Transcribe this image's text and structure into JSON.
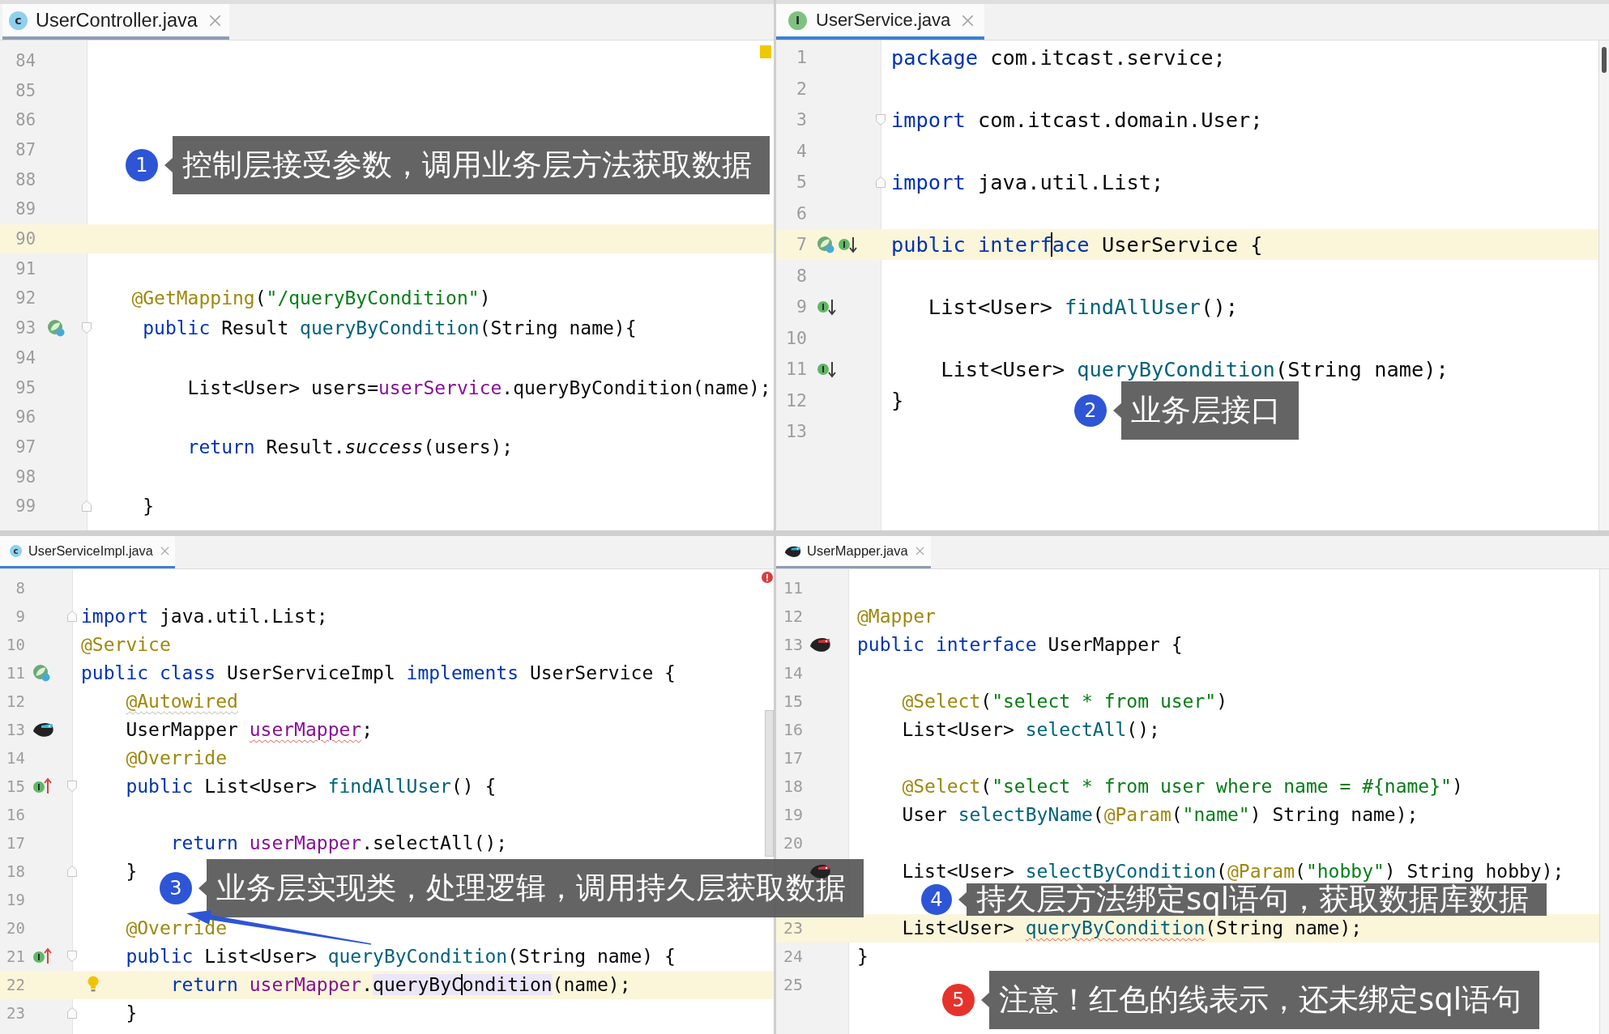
{
  "panes": [
    {
      "tab": {
        "label": "UserController.java",
        "icon": {
          "kind": "class",
          "letter": "c"
        },
        "selected": true
      },
      "focused": false,
      "indicator": {
        "kind": "warning"
      },
      "lines": [
        {
          "number": "84",
          "current": false
        },
        {
          "number": "85",
          "current": false
        },
        {
          "number": "86",
          "current": false
        },
        {
          "number": "87",
          "current": false
        },
        {
          "number": "88",
          "current": false
        },
        {
          "number": "89",
          "current": false
        },
        {
          "number": "90",
          "current": true
        },
        {
          "number": "91",
          "current": false
        },
        {
          "number": "92",
          "current": false,
          "code": [
            {
              "kind": "annotation",
              "text": "    @GetMapping"
            },
            {
              "kind": "plain",
              "text": "("
            },
            {
              "kind": "string",
              "text": "\"/queryByCondition\""
            },
            {
              "kind": "plain",
              "text": ")"
            }
          ]
        },
        {
          "number": "93",
          "current": false,
          "gutter": [
            {
              "kind": "bean"
            }
          ],
          "fold": {
            "kind": "start"
          },
          "code": [
            {
              "kind": "keyword",
              "text": "     public"
            },
            {
              "kind": "plain",
              "text": " Result "
            },
            {
              "kind": "method",
              "text": "queryByCondition"
            },
            {
              "kind": "plain",
              "text": "(String name){"
            }
          ]
        },
        {
          "number": "94",
          "current": false
        },
        {
          "number": "95",
          "current": false,
          "code": [
            {
              "kind": "plain",
              "text": "         List<User> users="
            },
            {
              "kind": "field",
              "text": "userService"
            },
            {
              "kind": "plain",
              "text": ".queryByCondition(name);"
            }
          ]
        },
        {
          "number": "96",
          "current": false
        },
        {
          "number": "97",
          "current": false,
          "code": [
            {
              "kind": "keyword",
              "text": "         return"
            },
            {
              "kind": "plain",
              "text": " Result."
            },
            {
              "kind": "static",
              "text": "success"
            },
            {
              "kind": "plain",
              "text": "(users);"
            }
          ]
        },
        {
          "number": "98",
          "current": false
        },
        {
          "number": "99",
          "current": false,
          "fold": {
            "kind": "end"
          },
          "code": [
            {
              "kind": "plain",
              "text": "     }"
            }
          ]
        }
      ]
    },
    {
      "tab": {
        "label": "UserService.java",
        "icon": {
          "kind": "interface",
          "letter": "I"
        },
        "selected": true
      },
      "focused": true,
      "lines": [
        {
          "number": "1",
          "current": false,
          "code": [
            {
              "kind": "keyword",
              "text": "package"
            },
            {
              "kind": "plain",
              "text": " com.itcast.service;"
            }
          ]
        },
        {
          "number": "2",
          "current": false
        },
        {
          "number": "3",
          "current": false,
          "fold": {
            "kind": "start"
          },
          "code": [
            {
              "kind": "keyword",
              "text": "import"
            },
            {
              "kind": "plain",
              "text": " com.itcast.domain.User;"
            }
          ]
        },
        {
          "number": "4",
          "current": false
        },
        {
          "number": "5",
          "current": false,
          "fold": {
            "kind": "end"
          },
          "code": [
            {
              "kind": "keyword",
              "text": "import"
            },
            {
              "kind": "plain",
              "text": " java.util.List;"
            }
          ]
        },
        {
          "number": "6",
          "current": false
        },
        {
          "number": "7",
          "current": true,
          "gutter": [
            {
              "kind": "bean"
            },
            {
              "kind": "implemented"
            }
          ],
          "code": [
            {
              "kind": "keyword",
              "text": "public interf",
              "cursor": true
            },
            {
              "kind": "keyword",
              "text": "ace"
            },
            {
              "kind": "plain",
              "text": " UserService {"
            }
          ]
        },
        {
          "number": "8",
          "current": false
        },
        {
          "number": "9",
          "current": false,
          "gutter": [
            {
              "kind": "implemented"
            }
          ],
          "code": [
            {
              "kind": "plain",
              "text": "   List<User> "
            },
            {
              "kind": "method",
              "text": "findAllUser"
            },
            {
              "kind": "plain",
              "text": "();"
            }
          ]
        },
        {
          "number": "10",
          "current": false
        },
        {
          "number": "11",
          "current": false,
          "gutter": [
            {
              "kind": "implemented"
            }
          ],
          "code": [
            {
              "kind": "plain",
              "text": "    List<User> "
            },
            {
              "kind": "method",
              "text": "queryByCondition"
            },
            {
              "kind": "plain",
              "text": "(String name);"
            }
          ]
        },
        {
          "number": "12",
          "current": false,
          "code": [
            {
              "kind": "plain",
              "text": "}"
            }
          ]
        },
        {
          "number": "13",
          "current": false
        }
      ]
    },
    {
      "tab": {
        "label": "UserServiceImpl.java",
        "icon": {
          "kind": "class",
          "letter": "c"
        },
        "selected": true
      },
      "focused": true,
      "indicator": {
        "kind": "error"
      },
      "lines": [
        {
          "number": "8",
          "current": false
        },
        {
          "number": "9",
          "current": false,
          "fold": {
            "kind": "end"
          },
          "code": [
            {
              "kind": "keyword",
              "text": "import"
            },
            {
              "kind": "plain",
              "text": " java.util.List;"
            }
          ]
        },
        {
          "number": "10",
          "current": false,
          "code": [
            {
              "kind": "annotation",
              "text": "@Service"
            }
          ]
        },
        {
          "number": "11",
          "current": false,
          "gutter": [
            {
              "kind": "bean"
            }
          ],
          "code": [
            {
              "kind": "keyword",
              "text": "public class"
            },
            {
              "kind": "plain",
              "text": " UserServiceImpl "
            },
            {
              "kind": "keyword",
              "text": "implements"
            },
            {
              "kind": "plain",
              "text": " UserService {"
            }
          ]
        },
        {
          "number": "12",
          "current": false,
          "code": [
            {
              "kind": "annotation",
              "text": "    @Autowired",
              "warning_underline": true
            }
          ]
        },
        {
          "number": "13",
          "current": false,
          "gutter": [
            {
              "kind": "mapper-field"
            }
          ],
          "code": [
            {
              "kind": "plain",
              "text": "    UserMapper "
            },
            {
              "kind": "field",
              "text": "userMapper",
              "error_underline": true
            },
            {
              "kind": "plain",
              "text": ";"
            }
          ]
        },
        {
          "number": "14",
          "current": false,
          "code": [
            {
              "kind": "annotation",
              "text": "    @Override"
            }
          ]
        },
        {
          "number": "15",
          "current": false,
          "gutter": [
            {
              "kind": "implementing"
            }
          ],
          "fold": {
            "kind": "start"
          },
          "code": [
            {
              "kind": "keyword",
              "text": "    public"
            },
            {
              "kind": "plain",
              "text": " List<User> "
            },
            {
              "kind": "method",
              "text": "findAllUser"
            },
            {
              "kind": "plain",
              "text": "() {"
            }
          ]
        },
        {
          "number": "16",
          "current": false
        },
        {
          "number": "17",
          "current": false,
          "code": [
            {
              "kind": "keyword",
              "text": "        return "
            },
            {
              "kind": "field",
              "text": "userMapper"
            },
            {
              "kind": "plain",
              "text": ".selectAll();"
            }
          ]
        },
        {
          "number": "18",
          "current": false,
          "fold": {
            "kind": "end"
          },
          "code": [
            {
              "kind": "plain",
              "text": "    }"
            }
          ]
        },
        {
          "number": "19",
          "current": false
        },
        {
          "number": "20",
          "current": false,
          "code": [
            {
              "kind": "annotation",
              "text": "    @Override"
            }
          ]
        },
        {
          "number": "21",
          "current": false,
          "gutter": [
            {
              "kind": "implementing"
            }
          ],
          "fold": {
            "kind": "start"
          },
          "code": [
            {
              "kind": "keyword",
              "text": "    public"
            },
            {
              "kind": "plain",
              "text": " List<User> "
            },
            {
              "kind": "method",
              "text": "queryByCondition"
            },
            {
              "kind": "plain",
              "text": "(String name) {"
            }
          ]
        },
        {
          "number": "22",
          "current": true,
          "bulb": true,
          "code": [
            {
              "kind": "keyword",
              "text": "        return "
            },
            {
              "kind": "field",
              "text": "userMapper"
            },
            {
              "kind": "plain",
              "text": "."
            },
            {
              "kind": "plain",
              "text": "queryByC",
              "highlight": true,
              "cursor": true
            },
            {
              "kind": "plain",
              "text": "ondition",
              "highlight": true
            },
            {
              "kind": "plain",
              "text": "(name);"
            }
          ]
        },
        {
          "number": "23",
          "current": false,
          "fold": {
            "kind": "end"
          },
          "code": [
            {
              "kind": "plain",
              "text": "    }"
            }
          ]
        }
      ]
    },
    {
      "tab": {
        "label": "UserMapper.java",
        "icon": {
          "kind": "mapper"
        },
        "selected": true
      },
      "focused": false,
      "lines": [
        {
          "number": "11",
          "current": false
        },
        {
          "number": "12",
          "current": false,
          "code": [
            {
              "kind": "annotation",
              "text": "@Mapper"
            }
          ]
        },
        {
          "number": "13",
          "current": false,
          "gutter": [
            {
              "kind": "mapper"
            }
          ],
          "code": [
            {
              "kind": "keyword",
              "text": "public interface"
            },
            {
              "kind": "plain",
              "text": " UserMapper {"
            }
          ]
        },
        {
          "number": "14",
          "current": false
        },
        {
          "number": "15",
          "current": false,
          "code": [
            {
              "kind": "annotation",
              "text": "    @Select"
            },
            {
              "kind": "plain",
              "text": "("
            },
            {
              "kind": "string",
              "text": "\"select * from user\""
            },
            {
              "kind": "plain",
              "text": ")"
            }
          ]
        },
        {
          "number": "16",
          "current": false,
          "code": [
            {
              "kind": "plain",
              "text": "    List<User> "
            },
            {
              "kind": "method",
              "text": "selectAll"
            },
            {
              "kind": "plain",
              "text": "();"
            }
          ]
        },
        {
          "number": "17",
          "current": false
        },
        {
          "number": "18",
          "current": false,
          "code": [
            {
              "kind": "annotation",
              "text": "    @Select"
            },
            {
              "kind": "plain",
              "text": "("
            },
            {
              "kind": "string",
              "text": "\"select * from user where name = #{name}\""
            },
            {
              "kind": "plain",
              "text": ")"
            }
          ]
        },
        {
          "number": "19",
          "current": false,
          "code": [
            {
              "kind": "plain",
              "text": "    User "
            },
            {
              "kind": "method",
              "text": "selectByName"
            },
            {
              "kind": "plain",
              "text": "("
            },
            {
              "kind": "annotation",
              "text": "@Param"
            },
            {
              "kind": "plain",
              "text": "("
            },
            {
              "kind": "string",
              "text": "\"name\""
            },
            {
              "kind": "plain",
              "text": ") String name);"
            }
          ]
        },
        {
          "number": "20",
          "current": false
        },
        {
          "current": false,
          "gutter": [
            {
              "kind": "mapper"
            }
          ],
          "code": [
            {
              "kind": "plain",
              "text": "    List<User> "
            },
            {
              "kind": "method",
              "text": "selectByCondition"
            },
            {
              "kind": "plain",
              "text": "("
            },
            {
              "kind": "annotation",
              "text": "@Param"
            },
            {
              "kind": "plain",
              "text": "("
            },
            {
              "kind": "string",
              "text": "\"hobby\""
            },
            {
              "kind": "plain",
              "text": ") String hobby);"
            }
          ]
        },
        {
          "current": false
        },
        {
          "number": "23",
          "current": true,
          "code": [
            {
              "kind": "plain",
              "text": "    List<User> "
            },
            {
              "kind": "method",
              "text": "queryByCondition",
              "error_underline": true
            },
            {
              "kind": "plain",
              "text": "(String name);"
            }
          ]
        },
        {
          "number": "24",
          "current": false,
          "code": [
            {
              "kind": "plain",
              "text": "}"
            }
          ]
        },
        {
          "number": "25",
          "current": false
        }
      ]
    }
  ],
  "callouts": [
    {
      "number": "1",
      "text": "控制层接受参数，调用业务层方法获取数据",
      "color": "#2e55d6",
      "arrow": false
    },
    {
      "number": "2",
      "text": "业务层接口",
      "color": "#2e55d6",
      "arrow": false
    },
    {
      "number": "3",
      "text": "业务层实现类，处理逻辑，调用持久层获取数据",
      "color": "#2e55d6",
      "arrow": true
    },
    {
      "number": "4",
      "text": "持久层方法绑定sql语句，获取数据库数据",
      "color": "#2e55d6",
      "arrow": false
    },
    {
      "number": "5",
      "text": "注意！红色的线表示，还未绑定sql语句",
      "color": "#e5332c",
      "arrow": false
    }
  ]
}
